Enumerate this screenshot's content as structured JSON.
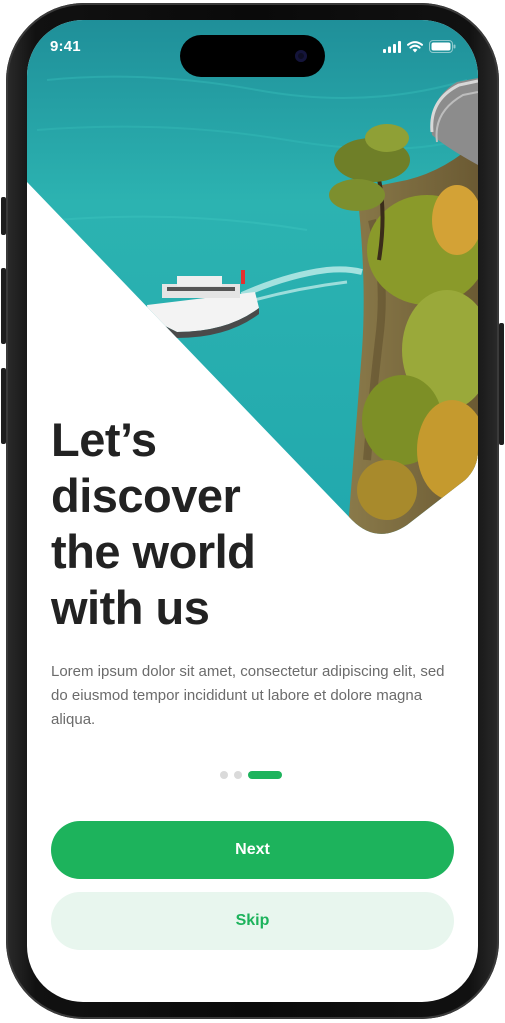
{
  "status_bar": {
    "time": "9:41",
    "icons": [
      "signal-icon",
      "wifi-icon",
      "battery-icon"
    ]
  },
  "onboarding": {
    "headline_lines": [
      "Let’s",
      "discover",
      "the world",
      "with us"
    ],
    "description": "Lorem ipsum dolor sit amet, consectetur adipiscing elit, sed do eiusmod tempor incididunt ut labore et dolore magna aliqua.",
    "pagination": {
      "total": 3,
      "active_index": 2
    },
    "next_label": "Next",
    "skip_label": "Skip"
  },
  "colors": {
    "accent": "#1DB35C",
    "accent_soft": "#E8F6EE",
    "headline": "#222222",
    "body": "#6B6B6B",
    "water": "#27B4B0"
  }
}
